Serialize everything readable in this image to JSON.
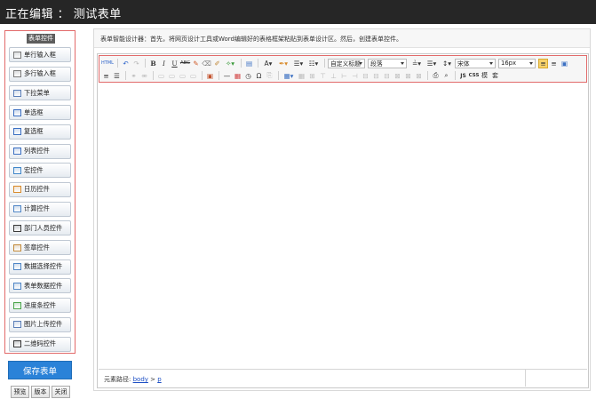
{
  "window": {
    "title": "正在编辑 ： 测试表单"
  },
  "sidebar": {
    "header": "表单控件",
    "items": [
      {
        "label": "单行输入框",
        "icon": "text-input-icon",
        "color": "#7a7a7a"
      },
      {
        "label": "多行输入框",
        "icon": "textarea-icon",
        "color": "#7a7a7a"
      },
      {
        "label": "下拉菜单",
        "icon": "dropdown-icon",
        "color": "#5b7fb8"
      },
      {
        "label": "单选框",
        "icon": "radio-icon",
        "color": "#3a6fc2"
      },
      {
        "label": "复选框",
        "icon": "checkbox-icon",
        "color": "#3a6fc2"
      },
      {
        "label": "列表控件",
        "icon": "list-control-icon",
        "color": "#3a6fc2"
      },
      {
        "label": "宏控件",
        "icon": "macro-icon",
        "color": "#3f86c9"
      },
      {
        "label": "日历控件",
        "icon": "calendar-icon",
        "color": "#d88a2a"
      },
      {
        "label": "计算控件",
        "icon": "calculator-icon",
        "color": "#4f86c6"
      },
      {
        "label": "部门人员控件",
        "icon": "department-user-icon",
        "color": "#3a3a3a"
      },
      {
        "label": "签章控件",
        "icon": "signature-icon",
        "color": "#c28a3a"
      },
      {
        "label": "数据选择控件",
        "icon": "data-select-icon",
        "color": "#4f86c6"
      },
      {
        "label": "表单数据控件",
        "icon": "form-data-icon",
        "color": "#4f86c6"
      },
      {
        "label": "进度条控件",
        "icon": "progress-icon",
        "color": "#4aa54a"
      },
      {
        "label": "图片上传控件",
        "icon": "image-upload-icon",
        "color": "#5b7fb8"
      },
      {
        "label": "二维码控件",
        "icon": "qrcode-icon",
        "color": "#333333"
      }
    ]
  },
  "footer": {
    "save_label": "保存表单",
    "preview_label": "预览",
    "version_label": "版本",
    "close_label": "关闭"
  },
  "main": {
    "intro": "表单智能设计器：首先，将网页设计工具或Word编辑好的表格框架粘贴到表单设计区。然后，创建表单控件。"
  },
  "toolbar": {
    "custom_title": "自定义标题",
    "paragraph": "段落",
    "font_family": "宋体",
    "font_size": "16px",
    "source_label": "HTML"
  },
  "pathbar": {
    "label": "元素路径:",
    "body": "body",
    "sep": " > ",
    "p": "p"
  },
  "colors": {
    "titlebar": "#262626",
    "save_button": "#2a82d8",
    "highlight_border": "#e26a6a",
    "link": "#1d4fc4"
  }
}
